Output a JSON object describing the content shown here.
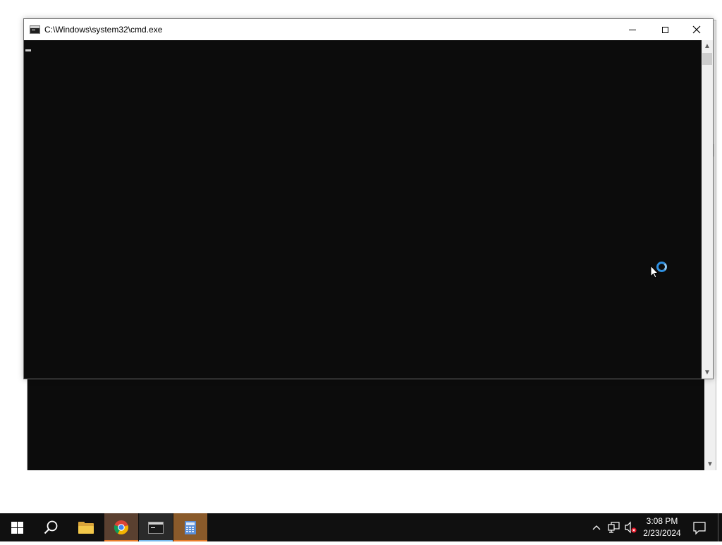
{
  "window": {
    "title": "C:\\Windows\\system32\\cmd.exe"
  },
  "taskbar": {
    "apps": [
      {
        "name": "Start"
      },
      {
        "name": "Search"
      },
      {
        "name": "File Explorer"
      },
      {
        "name": "Google Chrome"
      },
      {
        "name": "Command Prompt"
      },
      {
        "name": "Calculator"
      }
    ],
    "clock": {
      "time": "3:08 PM",
      "date": "2/23/2024"
    }
  },
  "colors": {
    "console_bg": "#0c0c0c",
    "taskbar_bg": "#101010",
    "accent_blue": "#76b9ed",
    "accent_orange": "#e87d2a",
    "busy_ring": "#2e8fe0"
  },
  "icons": {
    "console_icon": "cmd-icon",
    "minimize": "minimize-icon",
    "maximize": "maximize-icon",
    "close": "close-icon",
    "busy_cursor": "busy-cursor-icon",
    "network": "network-icon",
    "volume": "volume-muted-icon"
  }
}
